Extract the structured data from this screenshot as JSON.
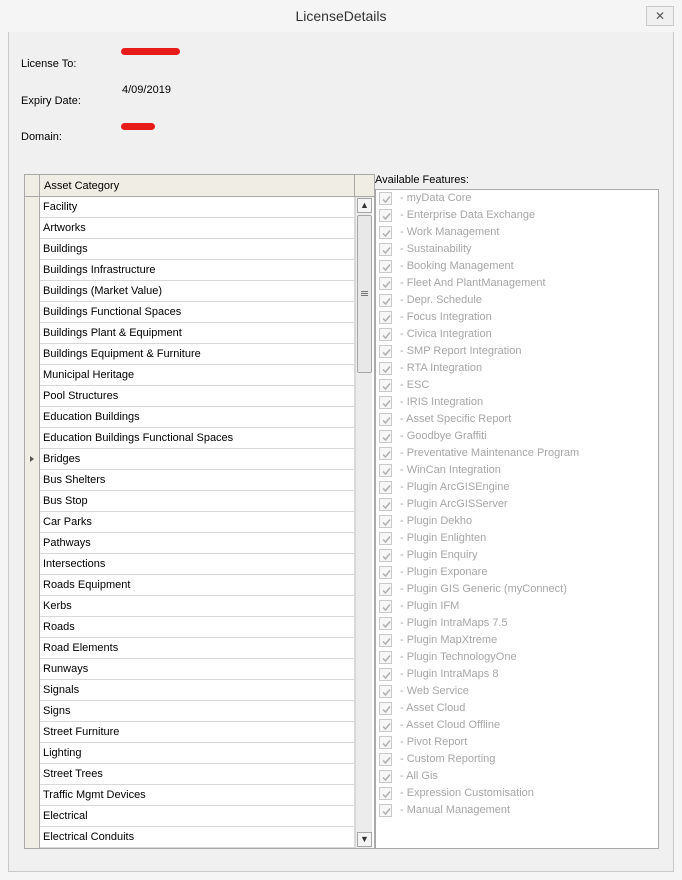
{
  "window": {
    "title": "LicenseDetails",
    "close_label": "✕"
  },
  "license": {
    "license_to_label": "License To:",
    "expiry_label": "Expiry Date:",
    "expiry_value": "4/09/2019",
    "domain_label": "Domain:"
  },
  "grid": {
    "header": "Asset Category",
    "rows": [
      "Facility",
      "Artworks",
      "Buildings",
      "Buildings Infrastructure",
      "Buildings (Market Value)",
      "Buildings Functional Spaces",
      "Buildings Plant & Equipment",
      "Buildings Equipment & Furniture",
      "Municipal Heritage",
      "Pool Structures",
      "Education Buildings",
      "Education Buildings Functional Spaces",
      "Bridges",
      "Bus Shelters",
      "Bus Stop",
      "Car Parks",
      "Pathways",
      "Intersections",
      "Roads Equipment",
      "Kerbs",
      "Roads",
      "Road Elements",
      "Runways",
      "Signals",
      "Signs",
      "Street Furniture",
      "Lighting",
      "Street Trees",
      "Traffic Mgmt Devices",
      "Electrical",
      "Electrical Conduits"
    ],
    "current_row": 12
  },
  "features": {
    "label": "Available Features:",
    "items": [
      "- myData Core",
      "- Enterprise Data Exchange",
      "- Work Management",
      "- Sustainability",
      "- Booking Management",
      "- Fleet And PlantManagement",
      "- Depr. Schedule",
      "- Focus Integration",
      "- Civica Integration",
      "- SMP Report Integration",
      "- RTA Integration",
      "- ESC",
      "- IRIS Integration",
      "- Asset Specific Report",
      "- Goodbye Graffiti",
      "- Preventative Maintenance Program",
      "- WinCan Integration",
      "- Plugin ArcGISEngine",
      "- Plugin ArcGISServer",
      "- Plugin Dekho",
      "- Plugin Enlighten",
      "- Plugin Enquiry",
      "- Plugin Exponare",
      "- Plugin GIS Generic (myConnect)",
      "- Plugin IFM",
      "- Plugin IntraMaps 7.5",
      "- Plugin MapXtreme",
      "- Plugin TechnologyOne",
      "- Plugin IntraMaps 8",
      "- Web Service",
      "- Asset Cloud",
      "- Asset Cloud Offline",
      "- Pivot Report",
      "- Custom Reporting",
      "- All Gis",
      "- Expression Customisation",
      "- Manual Management"
    ]
  },
  "colors": {
    "redaction": "#e81b1b",
    "disabled_text": "#a6a6a6"
  }
}
